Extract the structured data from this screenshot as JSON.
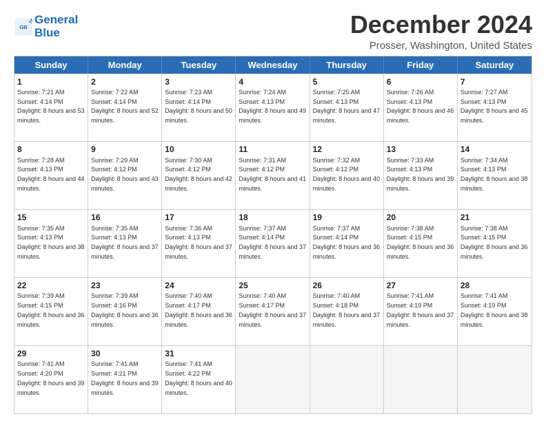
{
  "logo": {
    "line1": "General",
    "line2": "Blue"
  },
  "title": "December 2024",
  "subtitle": "Prosser, Washington, United States",
  "days": [
    "Sunday",
    "Monday",
    "Tuesday",
    "Wednesday",
    "Thursday",
    "Friday",
    "Saturday"
  ],
  "weeks": [
    [
      {
        "day": "1",
        "sunrise": "7:21 AM",
        "sunset": "4:14 PM",
        "daylight": "8 hours and 53 minutes."
      },
      {
        "day": "2",
        "sunrise": "7:22 AM",
        "sunset": "4:14 PM",
        "daylight": "8 hours and 52 minutes."
      },
      {
        "day": "3",
        "sunrise": "7:23 AM",
        "sunset": "4:14 PM",
        "daylight": "8 hours and 50 minutes."
      },
      {
        "day": "4",
        "sunrise": "7:24 AM",
        "sunset": "4:13 PM",
        "daylight": "8 hours and 49 minutes."
      },
      {
        "day": "5",
        "sunrise": "7:25 AM",
        "sunset": "4:13 PM",
        "daylight": "8 hours and 47 minutes."
      },
      {
        "day": "6",
        "sunrise": "7:26 AM",
        "sunset": "4:13 PM",
        "daylight": "8 hours and 46 minutes."
      },
      {
        "day": "7",
        "sunrise": "7:27 AM",
        "sunset": "4:13 PM",
        "daylight": "8 hours and 45 minutes."
      }
    ],
    [
      {
        "day": "8",
        "sunrise": "7:28 AM",
        "sunset": "4:13 PM",
        "daylight": "8 hours and 44 minutes."
      },
      {
        "day": "9",
        "sunrise": "7:29 AM",
        "sunset": "4:12 PM",
        "daylight": "8 hours and 43 minutes."
      },
      {
        "day": "10",
        "sunrise": "7:30 AM",
        "sunset": "4:12 PM",
        "daylight": "8 hours and 42 minutes."
      },
      {
        "day": "11",
        "sunrise": "7:31 AM",
        "sunset": "4:12 PM",
        "daylight": "8 hours and 41 minutes."
      },
      {
        "day": "12",
        "sunrise": "7:32 AM",
        "sunset": "4:12 PM",
        "daylight": "8 hours and 40 minutes."
      },
      {
        "day": "13",
        "sunrise": "7:33 AM",
        "sunset": "4:13 PM",
        "daylight": "8 hours and 39 minutes."
      },
      {
        "day": "14",
        "sunrise": "7:34 AM",
        "sunset": "4:13 PM",
        "daylight": "8 hours and 38 minutes."
      }
    ],
    [
      {
        "day": "15",
        "sunrise": "7:35 AM",
        "sunset": "4:13 PM",
        "daylight": "8 hours and 38 minutes."
      },
      {
        "day": "16",
        "sunrise": "7:35 AM",
        "sunset": "4:13 PM",
        "daylight": "8 hours and 37 minutes."
      },
      {
        "day": "17",
        "sunrise": "7:36 AM",
        "sunset": "4:13 PM",
        "daylight": "8 hours and 37 minutes."
      },
      {
        "day": "18",
        "sunrise": "7:37 AM",
        "sunset": "4:14 PM",
        "daylight": "8 hours and 37 minutes."
      },
      {
        "day": "19",
        "sunrise": "7:37 AM",
        "sunset": "4:14 PM",
        "daylight": "8 hours and 36 minutes."
      },
      {
        "day": "20",
        "sunrise": "7:38 AM",
        "sunset": "4:15 PM",
        "daylight": "8 hours and 36 minutes."
      },
      {
        "day": "21",
        "sunrise": "7:38 AM",
        "sunset": "4:15 PM",
        "daylight": "8 hours and 36 minutes."
      }
    ],
    [
      {
        "day": "22",
        "sunrise": "7:39 AM",
        "sunset": "4:15 PM",
        "daylight": "8 hours and 36 minutes."
      },
      {
        "day": "23",
        "sunrise": "7:39 AM",
        "sunset": "4:16 PM",
        "daylight": "8 hours and 36 minutes."
      },
      {
        "day": "24",
        "sunrise": "7:40 AM",
        "sunset": "4:17 PM",
        "daylight": "8 hours and 36 minutes."
      },
      {
        "day": "25",
        "sunrise": "7:40 AM",
        "sunset": "4:17 PM",
        "daylight": "8 hours and 37 minutes."
      },
      {
        "day": "26",
        "sunrise": "7:40 AM",
        "sunset": "4:18 PM",
        "daylight": "8 hours and 37 minutes."
      },
      {
        "day": "27",
        "sunrise": "7:41 AM",
        "sunset": "4:19 PM",
        "daylight": "8 hours and 37 minutes."
      },
      {
        "day": "28",
        "sunrise": "7:41 AM",
        "sunset": "4:19 PM",
        "daylight": "8 hours and 38 minutes."
      }
    ],
    [
      {
        "day": "29",
        "sunrise": "7:41 AM",
        "sunset": "4:20 PM",
        "daylight": "8 hours and 39 minutes."
      },
      {
        "day": "30",
        "sunrise": "7:41 AM",
        "sunset": "4:21 PM",
        "daylight": "8 hours and 39 minutes."
      },
      {
        "day": "31",
        "sunrise": "7:41 AM",
        "sunset": "4:22 PM",
        "daylight": "8 hours and 40 minutes."
      },
      null,
      null,
      null,
      null
    ]
  ]
}
